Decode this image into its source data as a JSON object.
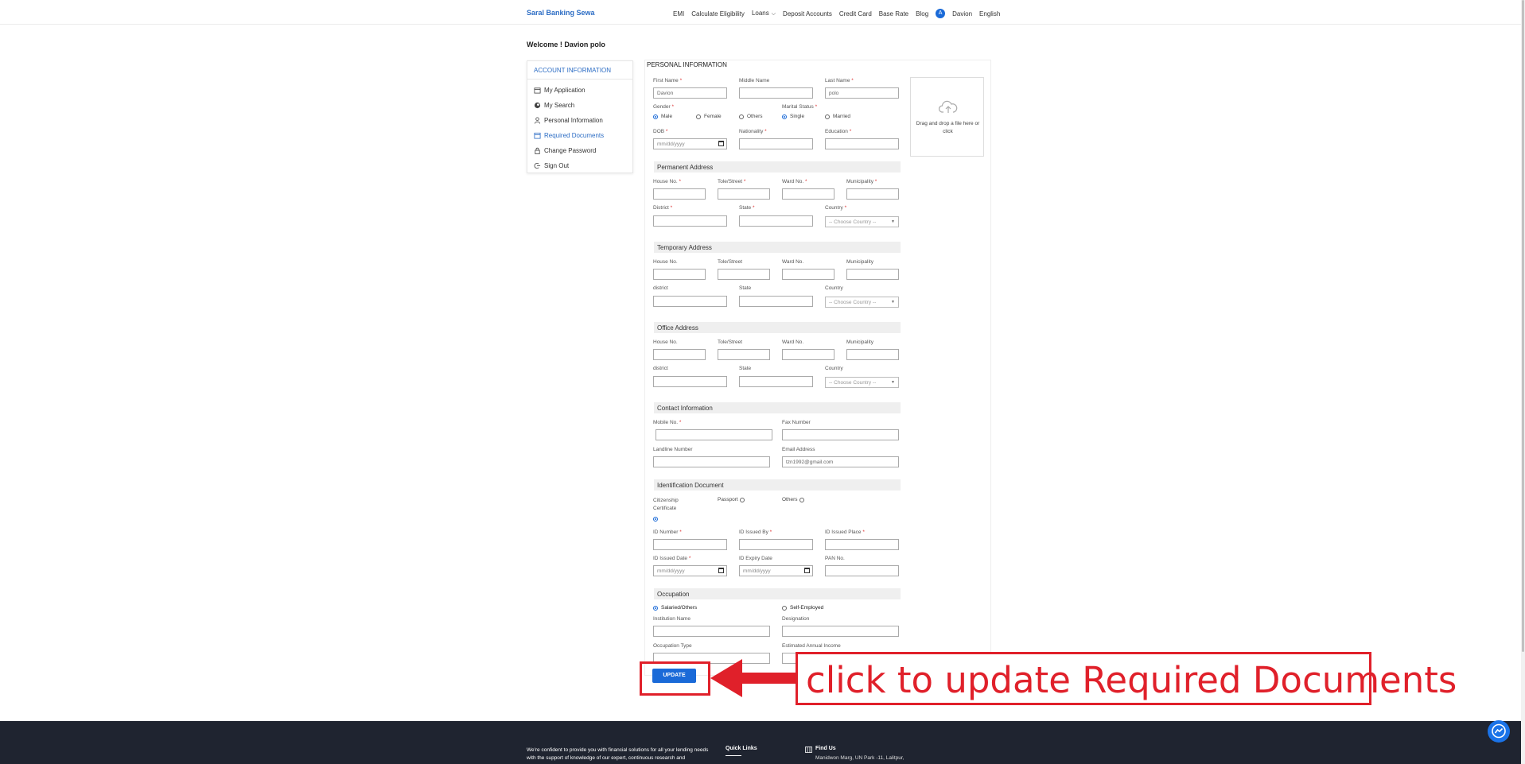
{
  "nav": {
    "brand": "Saral Banking Sewa",
    "links": [
      "EMI",
      "Calculate Eligibility",
      "Loans",
      "Deposit Accounts",
      "Credit Card",
      "Base Rate",
      "Blog"
    ],
    "avatar_letter": "A",
    "user": "Davion",
    "language": "English"
  },
  "welcome": "Welcome ! Davion polo",
  "sidebar": {
    "title": "ACCOUNT INFORMATION",
    "items": [
      {
        "label": "My Application",
        "icon": "calendar-icon"
      },
      {
        "label": "My Search",
        "icon": "globe-icon"
      },
      {
        "label": "Personal Information",
        "icon": "user-icon"
      },
      {
        "label": "Required Documents",
        "icon": "document-icon"
      },
      {
        "label": "Change Password",
        "icon": "lock-icon"
      },
      {
        "label": "Sign Out",
        "icon": "signout-icon"
      }
    ]
  },
  "personal": {
    "title": "PERSONAL INFORMATION",
    "first_name_label": "First Name",
    "first_name_value": "Davion",
    "middle_name_label": "Middle Name",
    "last_name_label": "Last Name",
    "last_name_value": "polo",
    "gender_label": "Gender",
    "gender_options": [
      "Male",
      "Female",
      "Others"
    ],
    "marital_label": "Marital Status",
    "marital_options": [
      "Single",
      "Married"
    ],
    "dob_label": "DOB",
    "date_placeholder": "mm/dd/yyyy",
    "nationality_label": "Nationality",
    "education_label": "Education",
    "dropzone_text": "Drag and drop a file here or click",
    "req": "*"
  },
  "address": {
    "permanent_title": "Permanent Address",
    "temporary_title": "Temporary Address",
    "office_title": "Office Address",
    "house_no": "House No.",
    "tole_street": "Tole/Street",
    "ward_no": "Ward No.",
    "municipality": "Municipality",
    "district_cap": "District",
    "district_lower": "district",
    "state": "State",
    "country": "Country",
    "country_placeholder": "-- Choose Country --"
  },
  "contact": {
    "title": "Contact Information",
    "mobile_label": "Mobile No.",
    "fax_label": "Fax Number",
    "landline_label": "Landline Number",
    "email_label": "Email Address",
    "email_value": "tzn1992@gmail.com"
  },
  "identification": {
    "title": "Identification Document",
    "citizenship": "Citizenship Certificate",
    "passport": "Passport",
    "others": "Others",
    "id_number": "ID Number",
    "id_issued_by": "ID Issued By",
    "id_issued_place": "ID Issued Place",
    "id_issued_date": "ID Issued Date",
    "id_expiry_date": "ID Expiry Date",
    "pan_no": "PAN No."
  },
  "occupation": {
    "title": "Occupation",
    "salaried": "Salaried/Others",
    "self_employed": "Self-Employed",
    "institution_name": "Institution Name",
    "designation": "Designation",
    "occupation_type": "Occupation Type",
    "estimated_income": "Estimated Annual Income"
  },
  "update_label": "UPDATE",
  "callout": "click to update Required Documents",
  "footer": {
    "about": "We're confident to provide you with financial solutions for all your lending needs with the support of knowledge of our expert, continuous research and",
    "quick_links": "Quick Links",
    "find_us": "Find Us",
    "address": "Manidwon Marg, UN Park -11, Lalitpur,"
  },
  "colors": {
    "accent": "#1a6ad8",
    "annotation": "#e0202a",
    "footer_bg": "#1f2430"
  }
}
